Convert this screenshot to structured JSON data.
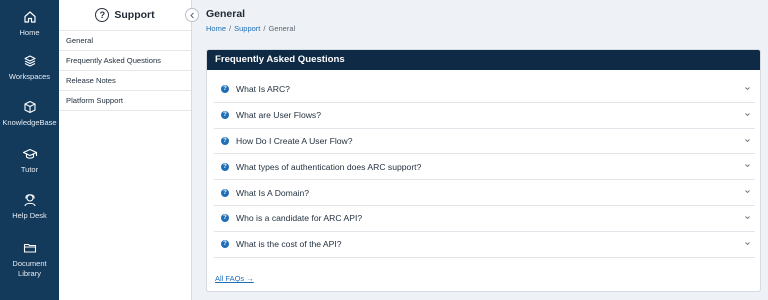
{
  "nav_rail": {
    "items": [
      {
        "label": "Home",
        "icon": "home-icon"
      },
      {
        "label": "Workspaces",
        "icon": "layers-icon"
      },
      {
        "label": "KnowledgeBase",
        "icon": "cube-icon"
      },
      {
        "label": "Tutor",
        "icon": "graduation-cap-icon"
      },
      {
        "label": "Help Desk",
        "icon": "headset-icon"
      },
      {
        "label": "Document Library",
        "icon": "folder-icon"
      }
    ]
  },
  "side_panel": {
    "title": "Support",
    "icon": "question-circle-icon",
    "items": [
      {
        "label": "General"
      },
      {
        "label": "Frequently Asked Questions"
      },
      {
        "label": "Release Notes"
      },
      {
        "label": "Platform Support"
      }
    ]
  },
  "page": {
    "title": "General",
    "breadcrumb": [
      "Home",
      "Support",
      "General"
    ]
  },
  "faq": {
    "heading": "Frequently Asked Questions",
    "items": [
      {
        "question": "What Is ARC?"
      },
      {
        "question": "What are User Flows?"
      },
      {
        "question": "How Do I Create A User Flow?"
      },
      {
        "question": "What types of authentication does ARC support?"
      },
      {
        "question": "What Is A Domain?"
      },
      {
        "question": "Who is a candidate for ARC API?"
      },
      {
        "question": "What is the cost of the API?"
      }
    ],
    "all_link": "All FAQs →"
  },
  "colors": {
    "rail_bg": "#13395b",
    "card_header_bg": "#0f2a45",
    "link": "#1f6fb6"
  }
}
